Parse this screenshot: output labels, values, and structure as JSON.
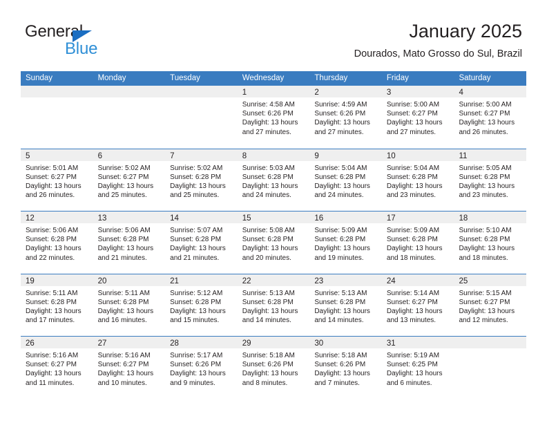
{
  "brand": {
    "name_part1": "General",
    "name_part2": "Blue"
  },
  "header": {
    "title": "January 2025",
    "subtitle": "Dourados, Mato Grosso do Sul, Brazil"
  },
  "colors": {
    "header_blue": "#3a7cc0",
    "day_band_gray": "#efefef",
    "logo_blue": "#2f8fd6",
    "text": "#231f20"
  },
  "calendar": {
    "weekdays": [
      "Sunday",
      "Monday",
      "Tuesday",
      "Wednesday",
      "Thursday",
      "Friday",
      "Saturday"
    ],
    "weeks": [
      [
        {
          "empty": true,
          "day": "",
          "sunrise": "",
          "sunset": "",
          "daylight1": "",
          "daylight2": ""
        },
        {
          "empty": true,
          "day": "",
          "sunrise": "",
          "sunset": "",
          "daylight1": "",
          "daylight2": ""
        },
        {
          "empty": true,
          "day": "",
          "sunrise": "",
          "sunset": "",
          "daylight1": "",
          "daylight2": ""
        },
        {
          "empty": false,
          "day": "1",
          "sunrise": "Sunrise: 4:58 AM",
          "sunset": "Sunset: 6:26 PM",
          "daylight1": "Daylight: 13 hours",
          "daylight2": "and 27 minutes."
        },
        {
          "empty": false,
          "day": "2",
          "sunrise": "Sunrise: 4:59 AM",
          "sunset": "Sunset: 6:26 PM",
          "daylight1": "Daylight: 13 hours",
          "daylight2": "and 27 minutes."
        },
        {
          "empty": false,
          "day": "3",
          "sunrise": "Sunrise: 5:00 AM",
          "sunset": "Sunset: 6:27 PM",
          "daylight1": "Daylight: 13 hours",
          "daylight2": "and 27 minutes."
        },
        {
          "empty": false,
          "day": "4",
          "sunrise": "Sunrise: 5:00 AM",
          "sunset": "Sunset: 6:27 PM",
          "daylight1": "Daylight: 13 hours",
          "daylight2": "and 26 minutes."
        }
      ],
      [
        {
          "empty": false,
          "day": "5",
          "sunrise": "Sunrise: 5:01 AM",
          "sunset": "Sunset: 6:27 PM",
          "daylight1": "Daylight: 13 hours",
          "daylight2": "and 26 minutes."
        },
        {
          "empty": false,
          "day": "6",
          "sunrise": "Sunrise: 5:02 AM",
          "sunset": "Sunset: 6:27 PM",
          "daylight1": "Daylight: 13 hours",
          "daylight2": "and 25 minutes."
        },
        {
          "empty": false,
          "day": "7",
          "sunrise": "Sunrise: 5:02 AM",
          "sunset": "Sunset: 6:28 PM",
          "daylight1": "Daylight: 13 hours",
          "daylight2": "and 25 minutes."
        },
        {
          "empty": false,
          "day": "8",
          "sunrise": "Sunrise: 5:03 AM",
          "sunset": "Sunset: 6:28 PM",
          "daylight1": "Daylight: 13 hours",
          "daylight2": "and 24 minutes."
        },
        {
          "empty": false,
          "day": "9",
          "sunrise": "Sunrise: 5:04 AM",
          "sunset": "Sunset: 6:28 PM",
          "daylight1": "Daylight: 13 hours",
          "daylight2": "and 24 minutes."
        },
        {
          "empty": false,
          "day": "10",
          "sunrise": "Sunrise: 5:04 AM",
          "sunset": "Sunset: 6:28 PM",
          "daylight1": "Daylight: 13 hours",
          "daylight2": "and 23 minutes."
        },
        {
          "empty": false,
          "day": "11",
          "sunrise": "Sunrise: 5:05 AM",
          "sunset": "Sunset: 6:28 PM",
          "daylight1": "Daylight: 13 hours",
          "daylight2": "and 23 minutes."
        }
      ],
      [
        {
          "empty": false,
          "day": "12",
          "sunrise": "Sunrise: 5:06 AM",
          "sunset": "Sunset: 6:28 PM",
          "daylight1": "Daylight: 13 hours",
          "daylight2": "and 22 minutes."
        },
        {
          "empty": false,
          "day": "13",
          "sunrise": "Sunrise: 5:06 AM",
          "sunset": "Sunset: 6:28 PM",
          "daylight1": "Daylight: 13 hours",
          "daylight2": "and 21 minutes."
        },
        {
          "empty": false,
          "day": "14",
          "sunrise": "Sunrise: 5:07 AM",
          "sunset": "Sunset: 6:28 PM",
          "daylight1": "Daylight: 13 hours",
          "daylight2": "and 21 minutes."
        },
        {
          "empty": false,
          "day": "15",
          "sunrise": "Sunrise: 5:08 AM",
          "sunset": "Sunset: 6:28 PM",
          "daylight1": "Daylight: 13 hours",
          "daylight2": "and 20 minutes."
        },
        {
          "empty": false,
          "day": "16",
          "sunrise": "Sunrise: 5:09 AM",
          "sunset": "Sunset: 6:28 PM",
          "daylight1": "Daylight: 13 hours",
          "daylight2": "and 19 minutes."
        },
        {
          "empty": false,
          "day": "17",
          "sunrise": "Sunrise: 5:09 AM",
          "sunset": "Sunset: 6:28 PM",
          "daylight1": "Daylight: 13 hours",
          "daylight2": "and 18 minutes."
        },
        {
          "empty": false,
          "day": "18",
          "sunrise": "Sunrise: 5:10 AM",
          "sunset": "Sunset: 6:28 PM",
          "daylight1": "Daylight: 13 hours",
          "daylight2": "and 18 minutes."
        }
      ],
      [
        {
          "empty": false,
          "day": "19",
          "sunrise": "Sunrise: 5:11 AM",
          "sunset": "Sunset: 6:28 PM",
          "daylight1": "Daylight: 13 hours",
          "daylight2": "and 17 minutes."
        },
        {
          "empty": false,
          "day": "20",
          "sunrise": "Sunrise: 5:11 AM",
          "sunset": "Sunset: 6:28 PM",
          "daylight1": "Daylight: 13 hours",
          "daylight2": "and 16 minutes."
        },
        {
          "empty": false,
          "day": "21",
          "sunrise": "Sunrise: 5:12 AM",
          "sunset": "Sunset: 6:28 PM",
          "daylight1": "Daylight: 13 hours",
          "daylight2": "and 15 minutes."
        },
        {
          "empty": false,
          "day": "22",
          "sunrise": "Sunrise: 5:13 AM",
          "sunset": "Sunset: 6:28 PM",
          "daylight1": "Daylight: 13 hours",
          "daylight2": "and 14 minutes."
        },
        {
          "empty": false,
          "day": "23",
          "sunrise": "Sunrise: 5:13 AM",
          "sunset": "Sunset: 6:28 PM",
          "daylight1": "Daylight: 13 hours",
          "daylight2": "and 14 minutes."
        },
        {
          "empty": false,
          "day": "24",
          "sunrise": "Sunrise: 5:14 AM",
          "sunset": "Sunset: 6:27 PM",
          "daylight1": "Daylight: 13 hours",
          "daylight2": "and 13 minutes."
        },
        {
          "empty": false,
          "day": "25",
          "sunrise": "Sunrise: 5:15 AM",
          "sunset": "Sunset: 6:27 PM",
          "daylight1": "Daylight: 13 hours",
          "daylight2": "and 12 minutes."
        }
      ],
      [
        {
          "empty": false,
          "day": "26",
          "sunrise": "Sunrise: 5:16 AM",
          "sunset": "Sunset: 6:27 PM",
          "daylight1": "Daylight: 13 hours",
          "daylight2": "and 11 minutes."
        },
        {
          "empty": false,
          "day": "27",
          "sunrise": "Sunrise: 5:16 AM",
          "sunset": "Sunset: 6:27 PM",
          "daylight1": "Daylight: 13 hours",
          "daylight2": "and 10 minutes."
        },
        {
          "empty": false,
          "day": "28",
          "sunrise": "Sunrise: 5:17 AM",
          "sunset": "Sunset: 6:26 PM",
          "daylight1": "Daylight: 13 hours",
          "daylight2": "and 9 minutes."
        },
        {
          "empty": false,
          "day": "29",
          "sunrise": "Sunrise: 5:18 AM",
          "sunset": "Sunset: 6:26 PM",
          "daylight1": "Daylight: 13 hours",
          "daylight2": "and 8 minutes."
        },
        {
          "empty": false,
          "day": "30",
          "sunrise": "Sunrise: 5:18 AM",
          "sunset": "Sunset: 6:26 PM",
          "daylight1": "Daylight: 13 hours",
          "daylight2": "and 7 minutes."
        },
        {
          "empty": false,
          "day": "31",
          "sunrise": "Sunrise: 5:19 AM",
          "sunset": "Sunset: 6:25 PM",
          "daylight1": "Daylight: 13 hours",
          "daylight2": "and 6 minutes."
        },
        {
          "empty": true,
          "day": "",
          "sunrise": "",
          "sunset": "",
          "daylight1": "",
          "daylight2": ""
        }
      ]
    ]
  }
}
